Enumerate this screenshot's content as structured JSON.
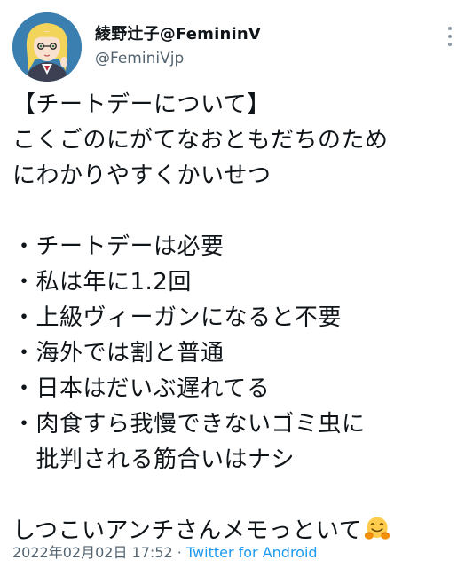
{
  "author": {
    "display_name": "綾野辻子@FemininV",
    "handle": "@FeminiVjp"
  },
  "tweet": {
    "body": "【チートデーについて】\nこくごのにがてなおともだちのため\nにわかりやすくかいせつ\n\n・チートデーは必要\n・私は年に1.2回\n・上級ヴィーガンになると不要\n・海外では割と普通\n・日本はだいぶ遅れてる\n・肉食すら我慢できないゴミ虫に\n　批判される筋合いはナシ\n\nしつこいアンチさんメモっといて",
    "emoji": "hugging-face-emoji"
  },
  "meta": {
    "timestamp": "2022年02月02日 17:52",
    "separator": " · ",
    "source": "Twitter for Android"
  },
  "icons": {
    "more": "more-options-icon",
    "avatar": "anime-girl-avatar"
  },
  "colors": {
    "text": "#0f1419",
    "secondary": "#536471",
    "link": "#1d9bf0"
  }
}
